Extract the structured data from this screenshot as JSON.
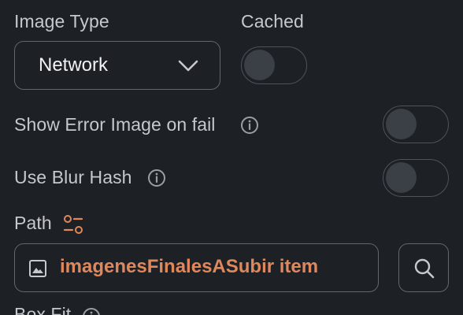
{
  "image_type": {
    "label": "Image Type",
    "selected": "Network",
    "icon": "chevron-down-icon"
  },
  "cached": {
    "label": "Cached",
    "enabled": false
  },
  "show_error_image": {
    "label": "Show Error Image on fail",
    "enabled": false,
    "icon": "info-icon"
  },
  "use_blur_hash": {
    "label": "Use Blur Hash",
    "enabled": false,
    "icon": "info-icon"
  },
  "path": {
    "label": "Path",
    "label_icon": "variable-toggle-icon",
    "value": "imagenesFinalesASubir item",
    "value_icon": "image-icon",
    "search_icon": "search-icon"
  },
  "box_fit": {
    "label": "Box Fit",
    "icon": "info-icon"
  },
  "colors": {
    "background": "#1d2025",
    "border": "#62666d",
    "path_value": "#e0875b",
    "toggle_knob": "#3b3f46"
  }
}
